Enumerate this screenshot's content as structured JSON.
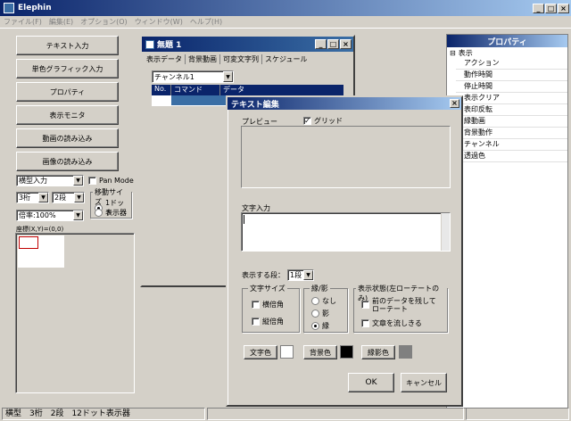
{
  "app": {
    "title": "Elephin"
  },
  "menu": [
    "ファイル(F)",
    "編集(E)",
    "オプション(O)",
    "ウィンドウ(W)",
    "ヘルプ(H)"
  ],
  "left": {
    "buttons": [
      "テキスト入力",
      "単色グラフィック入力",
      "プロパティ",
      "表示モニタ",
      "動画の読み込み",
      "画像の読み込み"
    ],
    "display_type": "横型入力",
    "pan_mode": "Pan Mode",
    "digits": "3桁",
    "lines": "2段",
    "move_size_label": "移動サイズ",
    "move_1dot": "1ドット",
    "move_display": "表示器",
    "zoom": "倍率:100%",
    "coords": "座標(X,Y)=(0,0)"
  },
  "doc": {
    "title": "無題 1",
    "tabs": [
      "表示データ",
      "背景動画",
      "可変文字列",
      "スケジュール"
    ],
    "channel": "チャンネル1",
    "cols": [
      "No.",
      "コマンド",
      "データ"
    ]
  },
  "dialog": {
    "title": "テキスト編集",
    "preview": "プレビュー",
    "grid": "グリッド",
    "text_input": "文字入力",
    "display_lines_label": "表示する段：",
    "display_lines": "1段",
    "font_size_label": "文字サイズ",
    "wide": "横倍角",
    "tall": "縦倍角",
    "edge_label": "縁/影",
    "none": "なし",
    "shadow": "影",
    "edge": "縁",
    "state_label": "表示状態(左ローテートのみ)",
    "keep_prev": "前のデータを残してローテート",
    "flow": "文章を流しきる",
    "text_color": "文字色",
    "bg_color": "背景色",
    "edge_color": "縁影色",
    "ok": "OK",
    "cancel": "キャンセル",
    "colors": {
      "text": "#ffffff",
      "bg": "#000000",
      "edge": "#808080"
    }
  },
  "props": {
    "title": "プロパティ",
    "root": "表示",
    "items": [
      "アクション",
      "動作時間",
      "停止時間",
      "表示クリア",
      "表印反転",
      "縁動画",
      "背景動作",
      "チャンネル",
      "透過色"
    ]
  },
  "status": {
    "text": "横型　3桁　2段　12ドット表示器"
  }
}
